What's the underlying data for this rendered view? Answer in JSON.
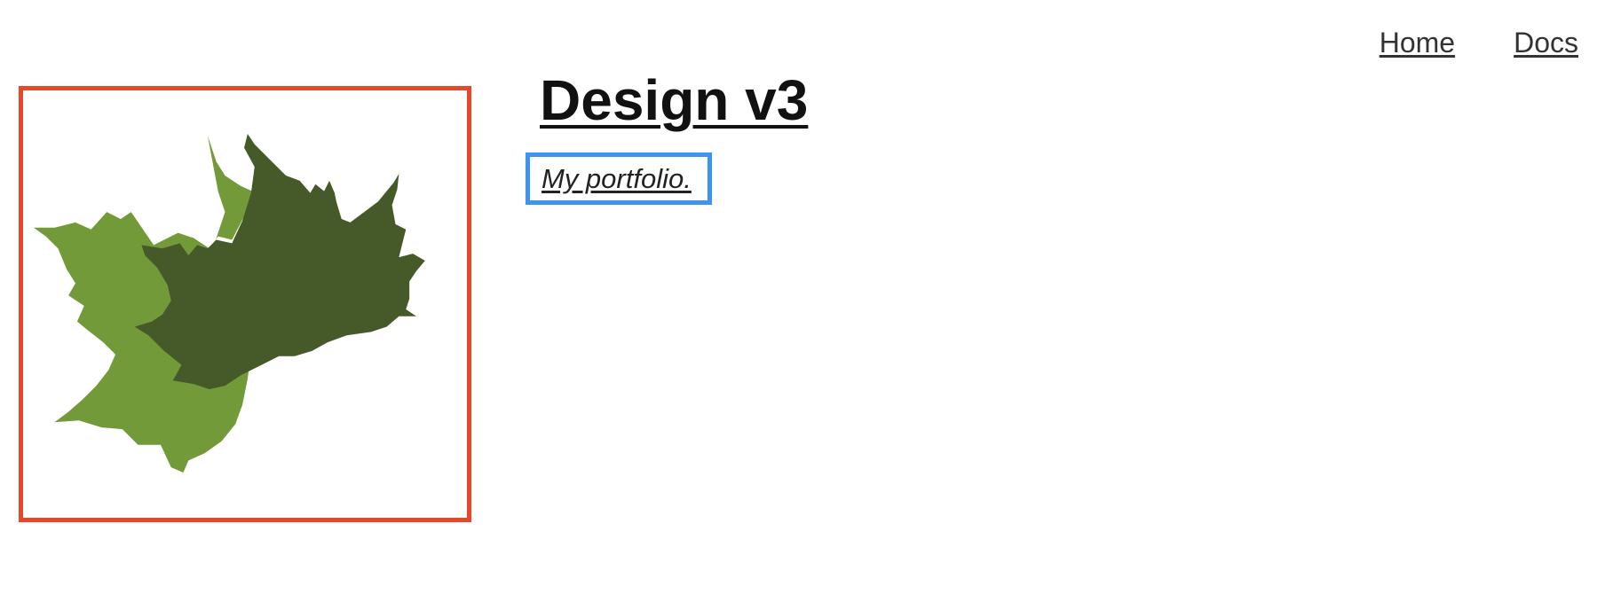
{
  "nav": {
    "items": [
      {
        "label": "Home"
      },
      {
        "label": "Docs"
      }
    ]
  },
  "hero": {
    "title": "Design v3",
    "tagline": "My portfolio.",
    "logo_icon": "maple-leaves-icon"
  },
  "colors": {
    "logo_border": "#e8472c",
    "tagline_border": "#3d94ec",
    "leaf_light": "#739a38",
    "leaf_dark": "#455a28"
  }
}
